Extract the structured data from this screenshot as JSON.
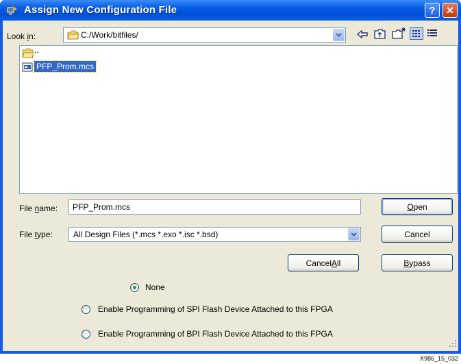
{
  "window": {
    "title": "Assign New Configuration File",
    "help_label": "?",
    "close_label": "✕"
  },
  "lookin": {
    "label_pre": "Look ",
    "label_key": "i",
    "label_post": "n:",
    "path": "C:/Work/bitfiles/"
  },
  "toolbar_icons": [
    "back-icon",
    "up-folder-icon",
    "new-folder-icon",
    "list-view-icon",
    "details-view-icon"
  ],
  "files": [
    {
      "name": "..",
      "icon": "folder-icon",
      "selected": false
    },
    {
      "name": "PFP_Prom.mcs",
      "icon": "file-icon",
      "selected": true
    }
  ],
  "filename": {
    "label_pre": "File ",
    "label_key": "n",
    "label_post": "ame:",
    "value": "PFP_Prom.mcs"
  },
  "filetype": {
    "label_pre": "File ",
    "label_key": "t",
    "label_post": "ype:",
    "value": "All Design Files (*.mcs *.exo *.isc *.bsd)"
  },
  "buttons": {
    "open_key": "O",
    "open_rest": "pen",
    "cancel": "Cancel",
    "cancel_all_pre": "Cancel ",
    "cancel_all_key": "A",
    "cancel_all_post": "ll",
    "bypass_key": "B",
    "bypass_rest": "ypass"
  },
  "options": [
    {
      "label": "None",
      "checked": true
    },
    {
      "label": "Enable Programming of SPI Flash Device Attached to this FPGA",
      "checked": false
    },
    {
      "label": "Enable Programming of BPI Flash Device Attached to this FPGA",
      "checked": false
    }
  ],
  "footer_id": "X986_15_032",
  "colors": {
    "titlebar": "#0a5fe6",
    "client": "#ece9d8",
    "selection": "#316ac5",
    "radio_dot": "#21a121"
  }
}
